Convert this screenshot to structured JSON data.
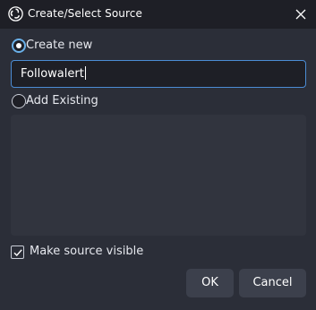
{
  "window": {
    "title": "Create/Select Source",
    "app_icon": "obs-logo-icon",
    "close_icon": "close-icon"
  },
  "options": {
    "create_new_label": "Create new",
    "create_new_selected": true,
    "add_existing_label": "Add Existing",
    "add_existing_selected": false
  },
  "name_input": {
    "value": "Followalert"
  },
  "existing_sources": [],
  "visibility": {
    "label": "Make source visible",
    "checked": true
  },
  "buttons": {
    "ok": "OK",
    "cancel": "Cancel"
  },
  "colors": {
    "background": "#2b2e38",
    "titlebar": "#1e1f26",
    "accent": "#4b8cd4",
    "button": "#3c404c"
  }
}
